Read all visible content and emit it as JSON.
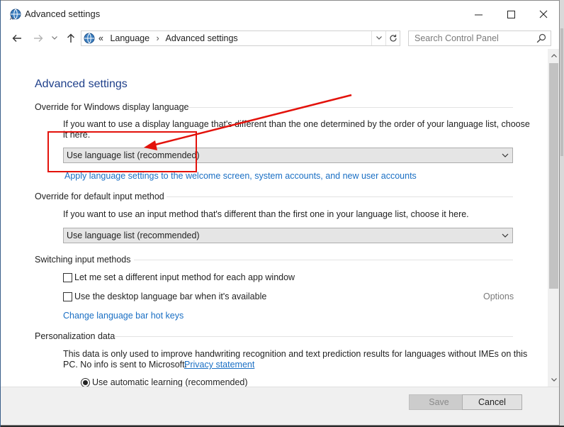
{
  "window": {
    "title": "Advanced settings",
    "controls": {
      "minimize": "—",
      "maximize": "☐",
      "close": "✕"
    }
  },
  "nav": {
    "back": "←",
    "forward": "→",
    "recent": "⌄",
    "up": "↑",
    "breadcrumb_prefix": "«",
    "breadcrumb": [
      "Language",
      "Advanced settings"
    ],
    "breadcrumb_sep": "›",
    "refresh": "↻",
    "dropdown": "▾"
  },
  "search": {
    "placeholder": "Search Control Panel"
  },
  "page": {
    "heading": "Advanced settings",
    "display_language": {
      "title": "Override for Windows display language",
      "description_line1": "If you want to use a display language that's different than the one determined by the order of your language list, choose",
      "description_line2": "it here.",
      "select_value": "Use language list (recommended)",
      "link": "Apply language settings to the welcome screen, system accounts, and new user accounts"
    },
    "input_method": {
      "title": "Override for default input method",
      "description": "If you want to use an input method that's different than the first one in your language list, choose it here.",
      "select_value": "Use language list (recommended)"
    },
    "switching": {
      "title": "Switching input methods",
      "checkbox1": "Let me set a different input method for each app window",
      "checkbox1_checked": false,
      "checkbox2": "Use the desktop language bar when it's available",
      "checkbox2_checked": false,
      "options": "Options",
      "hotkeys_link": "Change language bar hot keys"
    },
    "personalization": {
      "title": "Personalization data",
      "description_line1": "This data is only used to improve handwriting recognition and text prediction results for languages without IMEs on this",
      "description_line2": "PC. No info is sent to Microsoft.",
      "privacy_link": "Privacy statement",
      "radio1": "Use automatic learning (recommended)",
      "radio1_selected": true
    }
  },
  "footer": {
    "save": "Save",
    "cancel": "Cancel"
  },
  "colors": {
    "heading": "#1e3f8a",
    "link": "#1a6fc4",
    "annotation": "#e3120b"
  }
}
